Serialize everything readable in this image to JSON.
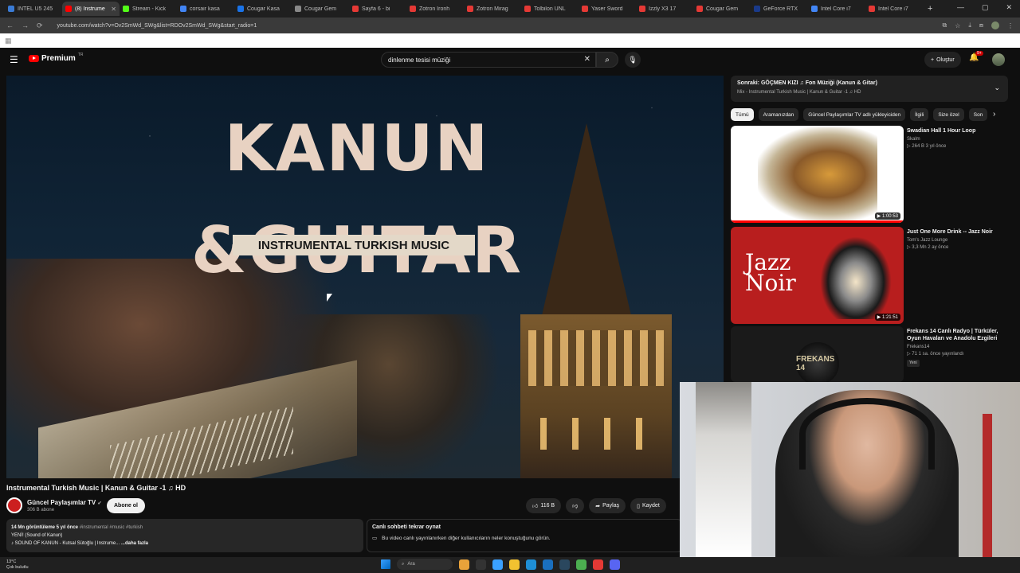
{
  "browser": {
    "tabs": [
      {
        "title": "INTEL U5 245",
        "color": "#3a7bd5",
        "active": false
      },
      {
        "title": "(8) Instrume",
        "color": "#ff0000",
        "active": true
      },
      {
        "title": "Stream - Kick",
        "color": "#53fc18",
        "active": false
      },
      {
        "title": "corsair kasa",
        "color": "#4285f4",
        "active": false
      },
      {
        "title": "Cougar Kasa",
        "color": "#1a73e8",
        "active": false
      },
      {
        "title": "Cougar Gem",
        "color": "#888888",
        "active": false
      },
      {
        "title": "Sayfa 6 - bi",
        "color": "#e53935",
        "active": false
      },
      {
        "title": "Zotron Ironh",
        "color": "#e53935",
        "active": false
      },
      {
        "title": "Zotron Mirag",
        "color": "#e53935",
        "active": false
      },
      {
        "title": "Tolbilon UNL",
        "color": "#e53935",
        "active": false
      },
      {
        "title": "Yaser Sword",
        "color": "#e53935",
        "active": false
      },
      {
        "title": "Izzly X3 17",
        "color": "#e53935",
        "active": false
      },
      {
        "title": "Cougar Gem",
        "color": "#e53935",
        "active": false
      },
      {
        "title": "GeForce RTX",
        "color": "#1a3a8a",
        "active": false
      },
      {
        "title": "Intel Core i7",
        "color": "#4285f4",
        "active": false
      },
      {
        "title": "Intel Core i7",
        "color": "#e53935",
        "active": false
      }
    ],
    "new_tab": "+",
    "url": "youtube.com/watch?v=Ov2SmWd_SWg&list=RDOv2SmWd_SWg&start_radio=1"
  },
  "youtube": {
    "logo_text": "Premium",
    "logo_sup": "TR",
    "search_value": "dinlenme tesisi müziği",
    "create_label": "Oluştur",
    "notif_count": "9+"
  },
  "video": {
    "thumb_title_line1": "KANUN",
    "thumb_title_line2": "&GUITAR",
    "thumb_band": "INSTRUMENTAL TURKISH MUSIC",
    "title": "Instrumental Turkish Music | Kanun & Guitar -1 ♫ HD",
    "channel": "Güncel Paylaşımlar TV",
    "subs": "306 B abone",
    "subscribe_label": "Abone ol",
    "likes": "116 B",
    "share_label": "Paylaş",
    "save_label": "Kaydet",
    "desc_stats": "14 Mn görüntüleme  5 yıl önce ",
    "desc_tags": "#instrumental #music #turkish",
    "desc_line2": "YENİ! (Sound of Kanun)",
    "desc_line3": "♪ SOUND OF KANUN - Kutsal Sütoğlu | Instrume...",
    "desc_more": "...daha fazla",
    "chat_title": "Canlı sohbeti tekrar oynat",
    "chat_msg": "Bu video canlı yayınlanırken diğer kullanıcıların neler konuştuğunu görün."
  },
  "playlist": {
    "next_title": "Sonraki: GÖÇMEN KIZI ♫ Fon Müziği (Kanun & Gitar)",
    "mix_sub": "Mix - Instrumental Turkish Music | Kanun & Guitar -1 ♫ HD"
  },
  "chips": [
    "Tümü",
    "Aramanızdan",
    "Güncel Paylaşımlar TV adlı yükleyiciden",
    "İlgili",
    "Size özel",
    "Son"
  ],
  "recs": [
    {
      "title": "Swadian Hall 1 Hour Loop",
      "channel": "Skalm",
      "meta": "▷ 264 B  3 yıl önce",
      "duration": "▶ 1:00:53"
    },
    {
      "title": "Just One More Drink -- Jazz Noir",
      "channel": "Tom's Jazz Lounge",
      "meta": "▷ 3,3 Mn  2 ay önce",
      "duration": "▶ 1:21:51",
      "thumb_text_1": "Jazz",
      "thumb_text_2": "Noir"
    },
    {
      "title": "Frekans 14 Canlı Radyo | Türküler, Oyun Havaları ve Anadolu Ezgileri",
      "channel": "Frekans14",
      "meta": "▷ 71  1 sa. önce yayınlandı",
      "badge": "Yeni",
      "thumb_text": "FREKANS 14"
    }
  ],
  "taskbar": {
    "weather_temp": "13°C",
    "weather_desc": "Çok bulutlu",
    "search_label": "Ara"
  }
}
